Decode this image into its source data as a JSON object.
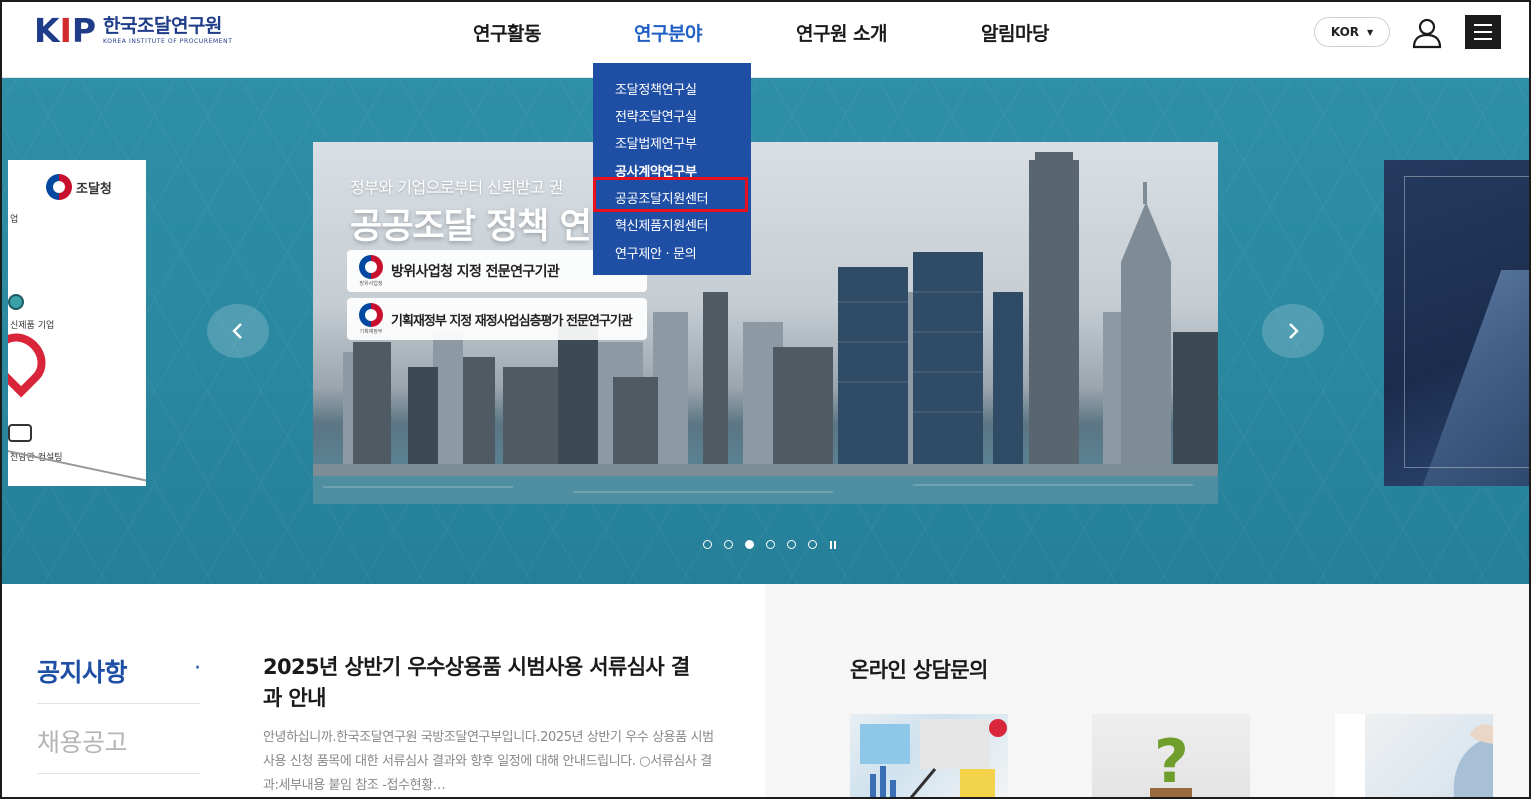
{
  "brand": {
    "logo_mark": "KIP",
    "name_ko": "한국조달연구원",
    "name_en": "KOREA INSTITUTE OF PROCUREMENT"
  },
  "nav": {
    "items": [
      {
        "label": "연구활동",
        "active": false
      },
      {
        "label": "연구분야",
        "active": true
      },
      {
        "label": "연구원 소개",
        "active": false
      },
      {
        "label": "알림마당",
        "active": false
      }
    ],
    "language": "KOR"
  },
  "dropdown": {
    "items": [
      {
        "label": "조달정책연구실",
        "bold": false
      },
      {
        "label": "전략조달연구실",
        "bold": false
      },
      {
        "label": "조달법제연구부",
        "bold": false
      },
      {
        "label": "공사계약연구부",
        "bold": true
      },
      {
        "label": "공공조달지원센터",
        "bold": false,
        "highlighted": true
      },
      {
        "label": "혁신제품지원센터",
        "bold": false
      },
      {
        "label": "연구제안 · 문의",
        "bold": false
      }
    ]
  },
  "hero": {
    "left_card": {
      "logo_text": "조달청",
      "text1": "업",
      "text2": "신제품 기업",
      "text3": "전담관 컨설팅"
    },
    "slide": {
      "subtitle": "정부와 기업으로부터 신뢰받고 권",
      "title": "공공조달 정책 연",
      "badge1_caption": "방위사업청",
      "badge1_text": "방위사업청 지정 전문연구기관",
      "badge2_caption": "기획재정부",
      "badge2_text": "기획재정부 지정 재정사업심층평가 전문연구기관"
    },
    "pagination": {
      "total": 6,
      "active_index": 2
    }
  },
  "board": {
    "tabs": [
      {
        "label": "공지사항",
        "active": true
      },
      {
        "label": "채용공고",
        "active": false
      }
    ],
    "tab_marker": "·",
    "notice_title": "2025년 상반기 우수상용품 시범사용 서류심사 결과 안내",
    "notice_desc": "안녕하십니까.한국조달연구원 국방조달연구부입니다.2025년 상반기 우수 상용품 시범사용 신청 품목에 대한 서류심사 결과와 향후 일정에 대해 안내드립니다. ○서류심사 결과:세부내용 붙임 참조 -접수현황…"
  },
  "consult": {
    "title": "온라인 상담문의"
  },
  "colors": {
    "brand_blue": "#1f4ea5",
    "nav_active": "#1f5fc6",
    "hero_bg": "#2a87a0",
    "highlight_red": "#e8101a"
  }
}
